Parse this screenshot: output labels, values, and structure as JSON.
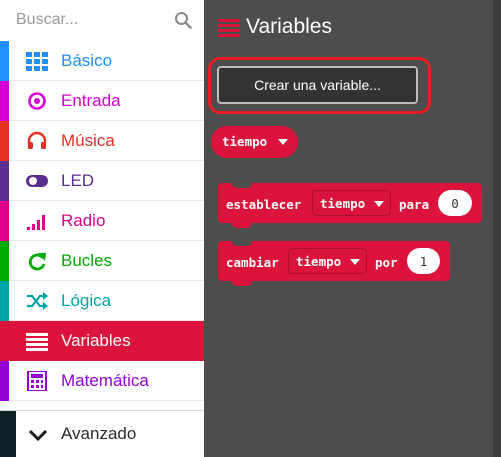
{
  "search": {
    "placeholder": "Buscar..."
  },
  "categories": [
    {
      "label": "Básico",
      "color": "#1e90ff",
      "icon": "grid-icon"
    },
    {
      "label": "Entrada",
      "color": "#d400d4",
      "icon": "target-icon"
    },
    {
      "label": "Música",
      "color": "#e63022",
      "icon": "headphones-icon"
    },
    {
      "label": "LED",
      "color": "#5c2d91",
      "icon": "toggle-icon"
    },
    {
      "label": "Radio",
      "color": "#e3008c",
      "icon": "signal-bars-icon"
    },
    {
      "label": "Bucles",
      "color": "#00aa00",
      "icon": "refresh-icon"
    },
    {
      "label": "Lógica",
      "color": "#00a4a6",
      "icon": "shuffle-icon"
    },
    {
      "label": "Variables",
      "color": "#dc143c",
      "icon": "list-icon",
      "selected": true
    },
    {
      "label": "Matemática",
      "color": "#9400d3",
      "icon": "calculator-icon"
    }
  ],
  "advanced": {
    "label": "Avanzado",
    "icon": "chevron-down-icon"
  },
  "flyout": {
    "title": "Variables",
    "create_button": "Crear una variable...",
    "variable_pill": "tiempo",
    "set_block": {
      "keyword": "establecer",
      "variable": "tiempo",
      "connector": "para",
      "value": "0"
    },
    "change_block": {
      "keyword": "cambiar",
      "variable": "tiempo",
      "connector": "por",
      "value": "1"
    }
  },
  "colors": {
    "accent": "#dc143c",
    "workspace": "#4d4d4d",
    "highlight": "#ec1c24"
  }
}
